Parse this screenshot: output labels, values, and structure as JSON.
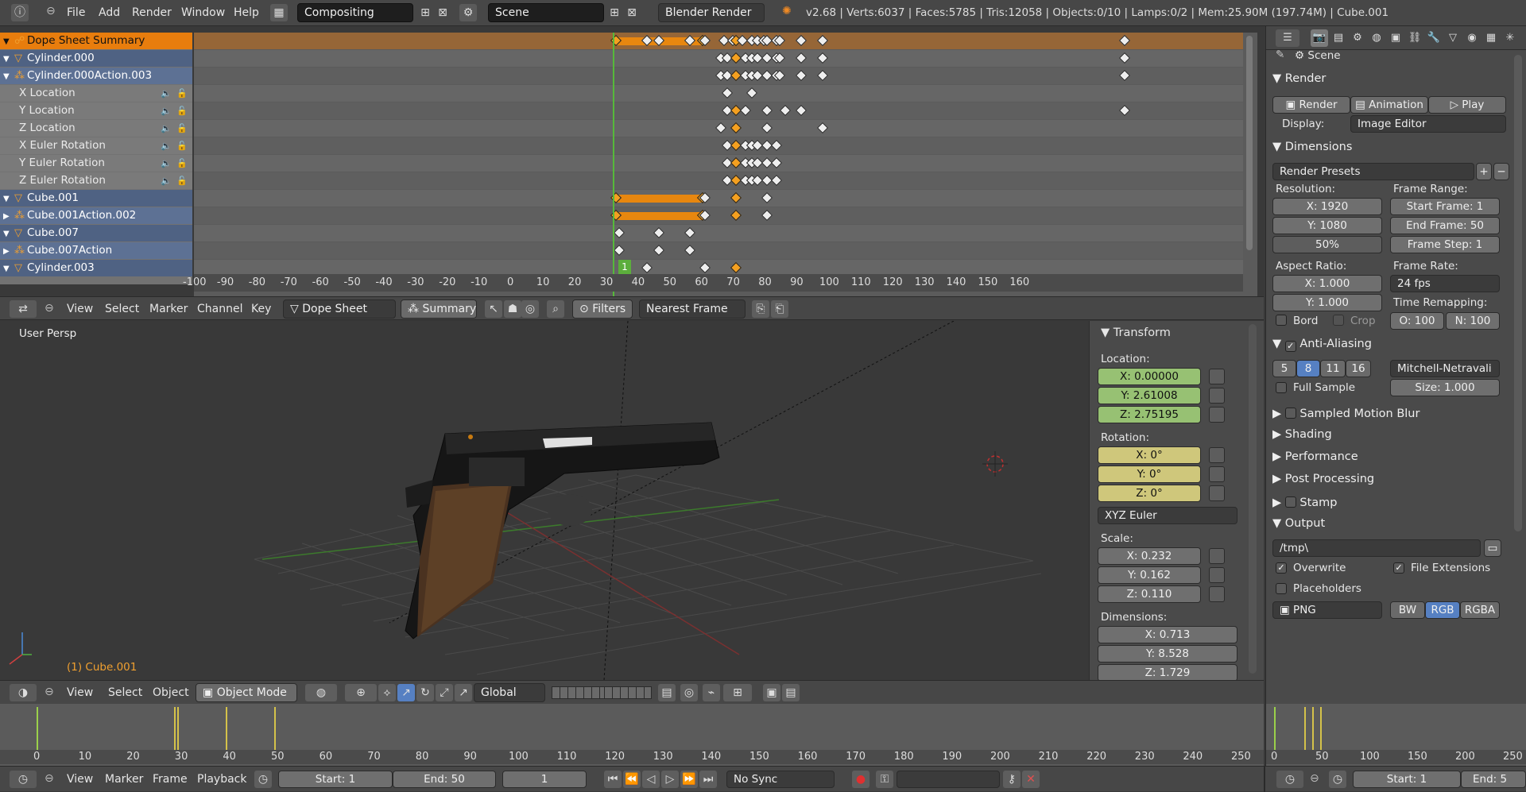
{
  "topbar": {
    "menus": [
      "File",
      "Add",
      "Render",
      "Window",
      "Help"
    ],
    "layout": "Compositing",
    "scene": "Scene",
    "engine": "Blender Render",
    "stats": "v2.68 | Verts:6037 | Faces:5785 | Tris:12058 | Objects:0/10 | Lamps:0/2 | Mem:25.90M (197.74M) | Cube.001"
  },
  "dopesheet": {
    "channels": [
      {
        "label": "Dope Sheet Summary",
        "kind": "sum",
        "tri": "▼"
      },
      {
        "label": "Cylinder.000",
        "kind": "obj",
        "tri": "▼"
      },
      {
        "label": "Cylinder.000Action.003",
        "kind": "act",
        "tri": "▼"
      },
      {
        "label": "X Location",
        "kind": "fc",
        "tri": ""
      },
      {
        "label": "Y Location",
        "kind": "fc",
        "tri": ""
      },
      {
        "label": "Z Location",
        "kind": "fc",
        "tri": ""
      },
      {
        "label": "X Euler Rotation",
        "kind": "fc",
        "tri": ""
      },
      {
        "label": "Y Euler Rotation",
        "kind": "fc",
        "tri": ""
      },
      {
        "label": "Z Euler Rotation",
        "kind": "fc",
        "tri": ""
      },
      {
        "label": "Cube.001",
        "kind": "obj",
        "tri": "▼"
      },
      {
        "label": "Cube.001Action.002",
        "kind": "act",
        "tri": "▶"
      },
      {
        "label": "Cube.007",
        "kind": "obj",
        "tri": "▼"
      },
      {
        "label": "Cube.007Action",
        "kind": "act",
        "tri": "▶"
      },
      {
        "label": "Cylinder.003",
        "kind": "obj",
        "tri": "▼"
      }
    ],
    "ruler": [
      "-100",
      "-90",
      "-80",
      "-70",
      "-60",
      "-50",
      "-40",
      "-30",
      "-20",
      "-10",
      "0",
      "10",
      "20",
      "30",
      "40",
      "50",
      "60",
      "70",
      "80",
      "90",
      "100",
      "110",
      "120",
      "130",
      "140",
      "150",
      "160"
    ],
    "current_frame": "1",
    "header": {
      "menus": [
        "View",
        "Select",
        "Marker",
        "Channel",
        "Key"
      ],
      "mode": "Dope Sheet",
      "summary": "Summary",
      "filters": "Filters",
      "snap": "Nearest Frame"
    }
  },
  "viewport": {
    "label": "User Persp",
    "object_label": "(1) Cube.001",
    "header": {
      "menus": [
        "View",
        "Select",
        "Object"
      ],
      "mode": "Object Mode",
      "orientation": "Global"
    }
  },
  "transform": {
    "title": "Transform",
    "location_label": "Location:",
    "location": [
      "X: 0.00000",
      "Y: 2.61008",
      "Z: 2.75195"
    ],
    "rotation_label": "Rotation:",
    "rotation": [
      "X: 0°",
      "Y: 0°",
      "Z: 0°"
    ],
    "rotation_mode": "XYZ Euler",
    "scale_label": "Scale:",
    "scale": [
      "X: 0.232",
      "Y: 0.162",
      "Z: 0.110"
    ],
    "dimensions_label": "Dimensions:",
    "dimensions": [
      "X: 0.713",
      "Y: 8.528",
      "Z: 1.729"
    ]
  },
  "props": {
    "scene": "Scene",
    "render": {
      "title": "Render",
      "render_btn": "Render",
      "animation_btn": "Animation",
      "play_btn": "Play",
      "display_label": "Display:",
      "display": "Image Editor"
    },
    "dimensions": {
      "title": "Dimensions",
      "presets": "Render Presets",
      "resolution_label": "Resolution:",
      "res_x": "X: 1920",
      "res_y": "Y: 1080",
      "res_pct": "50%",
      "frame_range_label": "Frame Range:",
      "start": "Start Frame: 1",
      "end": "End Frame: 50",
      "step": "Frame Step: 1",
      "aspect_label": "Aspect Ratio:",
      "asp_x": "X: 1.000",
      "asp_y": "Y: 1.000",
      "frame_rate_label": "Frame Rate:",
      "fps": "24 fps",
      "remap_label": "Time Remapping:",
      "remap_o": "O: 100",
      "remap_n": "N: 100",
      "bord": "Bord",
      "crop": "Crop"
    },
    "aa": {
      "title": "Anti-Aliasing",
      "samples": [
        "5",
        "8",
        "11",
        "16"
      ],
      "filter": "Mitchell-Netravali",
      "full_sample": "Full Sample",
      "size": "Size: 1.000"
    },
    "panels": [
      "Sampled Motion Blur",
      "Shading",
      "Performance",
      "Post Processing",
      "Stamp"
    ],
    "output": {
      "title": "Output",
      "path": "/tmp\\",
      "overwrite": "Overwrite",
      "file_ext": "File Extensions",
      "placeholders": "Placeholders",
      "format": "PNG",
      "bw": "BW",
      "rgb": "RGB",
      "rgba": "RGBA"
    }
  },
  "timeline": {
    "ruler": [
      "0",
      "10",
      "20",
      "30",
      "40",
      "50",
      "60",
      "70",
      "80",
      "90",
      "100",
      "110",
      "120",
      "130",
      "140",
      "150",
      "160",
      "170",
      "180",
      "190",
      "200",
      "210",
      "220",
      "230",
      "240",
      "250"
    ],
    "ruler2": [
      "0",
      "50",
      "100",
      "150",
      "200",
      "250"
    ],
    "header": {
      "menus": [
        "View",
        "Marker",
        "Frame",
        "Playback"
      ],
      "start": "Start: 1",
      "end": "End: 50",
      "current": "1",
      "sync": "No Sync",
      "start2": "Start: 1",
      "end2": "End: 5"
    }
  }
}
